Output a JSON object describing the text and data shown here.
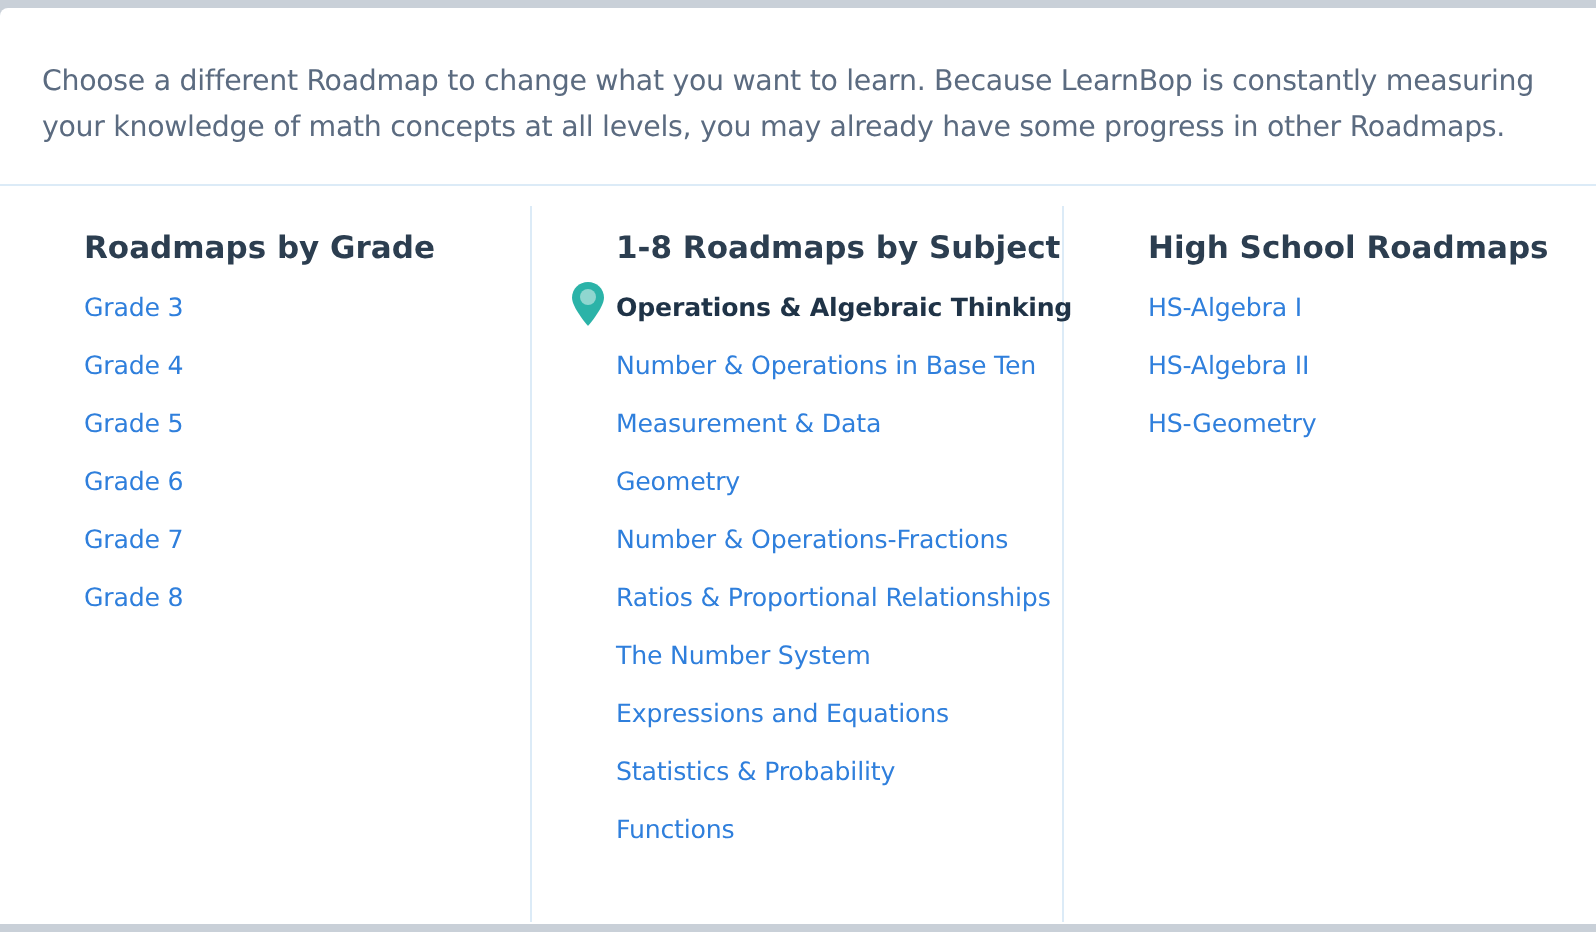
{
  "intro": "Choose a different Roadmap to change what you want to learn. Because LearnBop is constantly measuring your knowledge of math concepts at all levels, you may already have some progress in other Roadmaps.",
  "columns": [
    {
      "heading": "Roadmaps by Grade",
      "items": [
        {
          "label": "Grade 3",
          "selected": false
        },
        {
          "label": "Grade 4",
          "selected": false
        },
        {
          "label": "Grade 5",
          "selected": false
        },
        {
          "label": "Grade 6",
          "selected": false
        },
        {
          "label": "Grade 7",
          "selected": false
        },
        {
          "label": "Grade 8",
          "selected": false
        }
      ]
    },
    {
      "heading": "1-8 Roadmaps by Subject",
      "items": [
        {
          "label": "Operations & Algebraic Thinking",
          "selected": true
        },
        {
          "label": "Number & Operations in Base Ten",
          "selected": false
        },
        {
          "label": "Measurement & Data",
          "selected": false
        },
        {
          "label": "Geometry",
          "selected": false
        },
        {
          "label": "Number & Operations-Fractions",
          "selected": false
        },
        {
          "label": "Ratios & Proportional Relationships",
          "selected": false
        },
        {
          "label": "The Number System",
          "selected": false
        },
        {
          "label": "Expressions and Equations",
          "selected": false
        },
        {
          "label": "Statistics & Probability",
          "selected": false
        },
        {
          "label": "Functions",
          "selected": false
        }
      ]
    },
    {
      "heading": "High School Roadmaps",
      "items": [
        {
          "label": "HS-Algebra I",
          "selected": false
        },
        {
          "label": "HS-Algebra II",
          "selected": false
        },
        {
          "label": "HS-Geometry",
          "selected": false
        }
      ]
    }
  ]
}
